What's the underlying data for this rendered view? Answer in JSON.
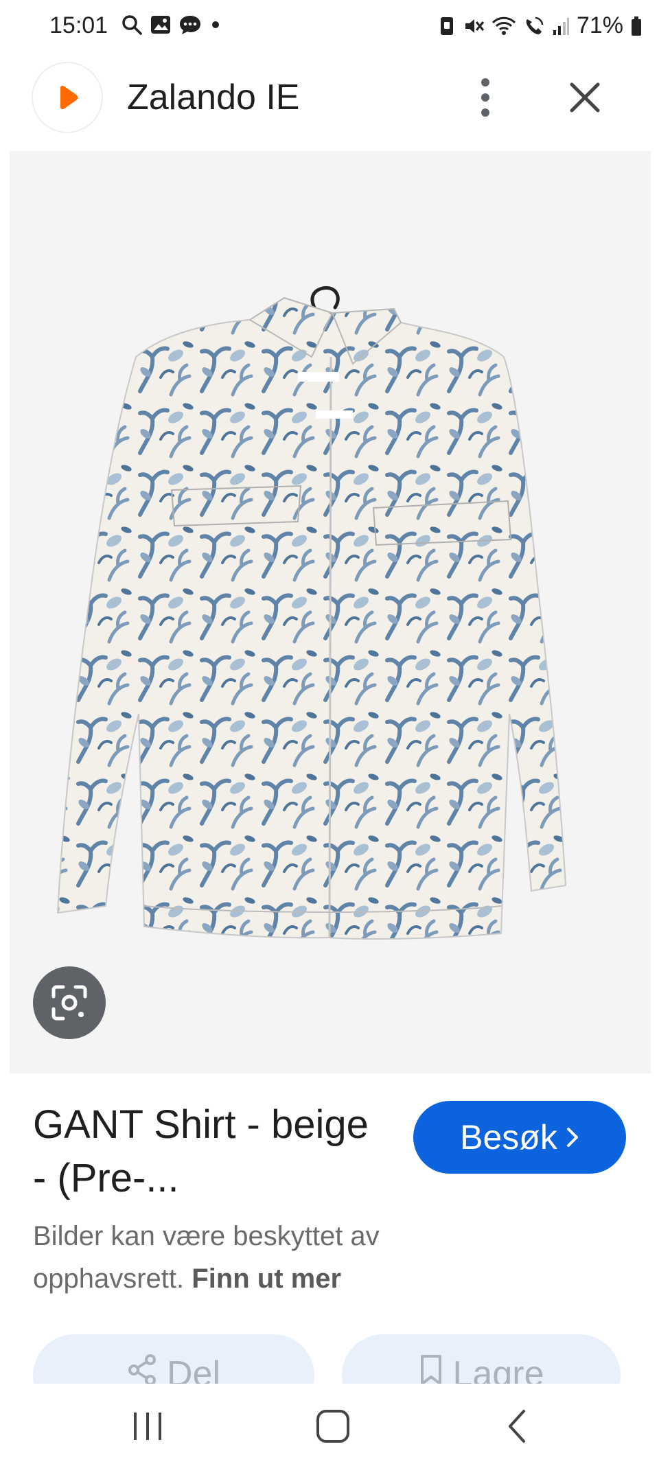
{
  "status_bar": {
    "time": "15:01",
    "battery": "71%",
    "icons_left": [
      "search-icon",
      "gallery-icon",
      "chat-icon",
      "dot-icon"
    ],
    "icons_right": [
      "vibrate-icon",
      "mute-icon",
      "wifi-icon",
      "wifi-call-icon",
      "signal-icon",
      "battery-icon"
    ]
  },
  "header": {
    "title": "Zalando IE",
    "logo_color": "#ff6900"
  },
  "image": {
    "description_icon": "lens-icon",
    "background": "#f4f4f5",
    "print_color": "#5f84a8"
  },
  "product": {
    "title": "GANT Shirt - beige - (Pre-...",
    "visit_label": "Besøk",
    "visit_color": "#0b64dd"
  },
  "copyright": {
    "text": "Bilder kan være beskyttet av opphavsrett.",
    "link": "Finn ut mer"
  },
  "actions": {
    "share_label": "Del",
    "save_label": "Lagre"
  }
}
